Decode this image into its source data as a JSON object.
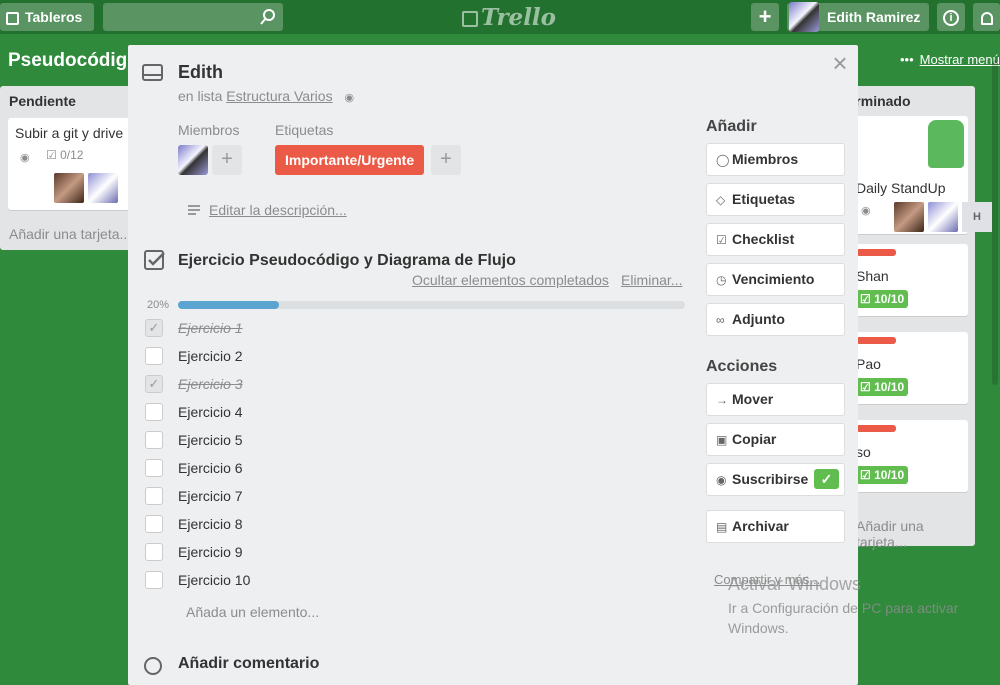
{
  "topbar": {
    "boards_label": "Tableros",
    "logo": "Trello",
    "user_name": "Edith Ramirez",
    "plus_glyph": "+",
    "info_glyph": "i"
  },
  "board": {
    "title": "Pseudocódigo",
    "show_menu_label": "Mostrar menú",
    "lists": {
      "pending": {
        "title": "Pendiente",
        "card_title": "Subir a git y drive",
        "checklist_badge": "0/12",
        "add_card": "Añadir una tarjeta..."
      },
      "done": {
        "title": "Terminado",
        "card_title": "Daily StandUp",
        "avatar_initial": "H",
        "cards": [
          {
            "title": "Shan",
            "badge": "10/10"
          },
          {
            "title": "Pao",
            "badge": "10/10"
          },
          {
            "title": "so",
            "badge": "10/10"
          }
        ],
        "add_card": "Añadir una tarjeta..."
      }
    }
  },
  "modal": {
    "title": "Edith",
    "in_list_prefix": "en lista",
    "list_name": "Estructura Varios",
    "members_label": "Miembros",
    "labels_label": "Etiquetas",
    "label_tag": "Importante/Urgente",
    "edit_description": "Editar la descripción...",
    "checklist": {
      "title": "Ejercicio Pseudocódigo y Diagrama de Flujo",
      "hide_completed": "Ocultar elementos completados",
      "delete": "Eliminar...",
      "progress_label": "20%",
      "progress": 0.2,
      "items": [
        {
          "text": "Ejercicio 1",
          "done": true
        },
        {
          "text": "Ejercicio 2",
          "done": false
        },
        {
          "text": "Ejercicio 3",
          "done": true
        },
        {
          "text": "Ejercicio 4",
          "done": false
        },
        {
          "text": "Ejercicio 5",
          "done": false
        },
        {
          "text": "Ejercicio 6",
          "done": false
        },
        {
          "text": "Ejercicio 7",
          "done": false
        },
        {
          "text": "Ejercicio 8",
          "done": false
        },
        {
          "text": "Ejercicio 9",
          "done": false
        },
        {
          "text": "Ejercicio 10",
          "done": false
        }
      ],
      "add_item": "Añada un elemento..."
    },
    "add_comment": "Añadir comentario",
    "sidebar": {
      "add_heading": "Añadir",
      "add_buttons": [
        {
          "label": "Miembros",
          "icon": "person-icon"
        },
        {
          "label": "Etiquetas",
          "icon": "tag-icon"
        },
        {
          "label": "Checklist",
          "icon": "checklist-icon"
        },
        {
          "label": "Vencimiento",
          "icon": "clock-icon"
        },
        {
          "label": "Adjunto",
          "icon": "paperclip-icon"
        }
      ],
      "actions_heading": "Acciones",
      "move": "Mover",
      "copy": "Copiar",
      "subscribe": "Suscribirse",
      "archive": "Archivar",
      "share": "Compartir y más..."
    }
  },
  "watermark": {
    "line1": "Activar Windows",
    "line2": "Ir a Configuración de PC para activar Windows."
  },
  "colors": {
    "board_bg": "#2f8a3c",
    "header_bg": "#23712f",
    "label_red": "#eb5a46",
    "badge_green": "#61bd4f",
    "progress_blue": "#5ba4cf"
  }
}
